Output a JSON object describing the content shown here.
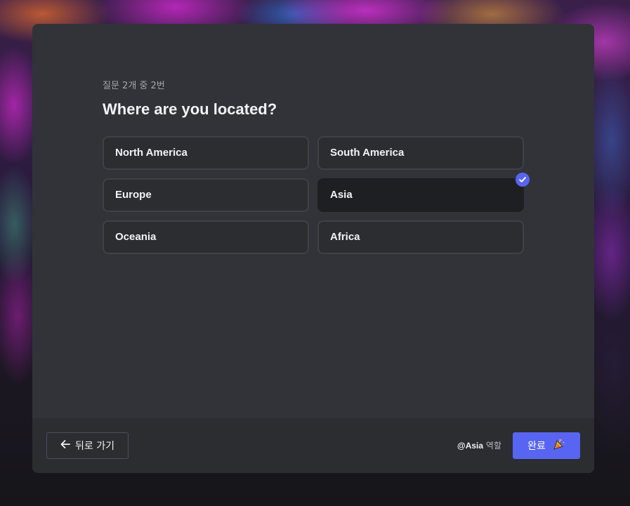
{
  "progress": {
    "text": "질문 2개 중 2번",
    "current": 2,
    "total": 2
  },
  "question": {
    "title": "Where are you located?"
  },
  "options": [
    {
      "label": "North America",
      "selected": false
    },
    {
      "label": "South America",
      "selected": false
    },
    {
      "label": "Europe",
      "selected": false
    },
    {
      "label": "Asia",
      "selected": true
    },
    {
      "label": "Oceania",
      "selected": false
    },
    {
      "label": "Africa",
      "selected": false
    }
  ],
  "footer": {
    "back_label": "뒤로 가기",
    "role_mention": "@Asia",
    "role_suffix": "역할",
    "done_label": "완료"
  },
  "icons": {
    "back": "arrow-left-icon",
    "check": "checkmark-icon",
    "done": "party-popper-icon"
  },
  "colors": {
    "accent": "#5865f2",
    "modal_bg": "#313338",
    "footer_bg": "#2b2d31",
    "selected_bg": "#1e1f22"
  }
}
